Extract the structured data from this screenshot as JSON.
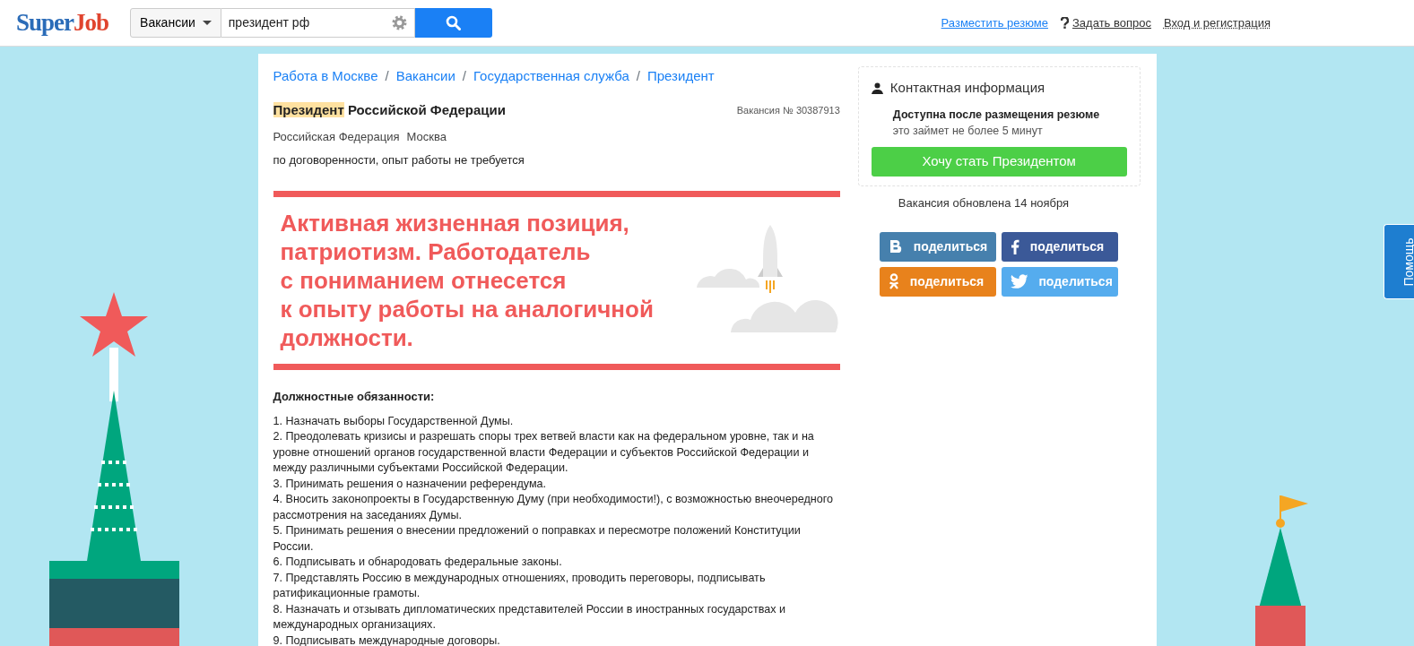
{
  "header": {
    "logo": {
      "first": "Super",
      "second": "Job"
    },
    "search_type": "Вакансии",
    "search_value": "президент рф",
    "links": [
      {
        "kind": "resume",
        "label": "Разместить резюме"
      },
      {
        "kind": "question",
        "label": "Задать вопрос"
      },
      {
        "kind": "login",
        "label": "Вход и регистрация"
      }
    ]
  },
  "breadcrumbs": {
    "separator": "/",
    "items": [
      "Работа в Москве",
      "Вакансии",
      "Государственная служба",
      "Президент"
    ]
  },
  "vacancy": {
    "title_highlight": "Президент",
    "title_rest": "Российской Федерации",
    "number": "Вакансия № 30387913",
    "region": "Российская Федерация",
    "city": "Москва",
    "terms": "по договоренности, опыт работы не требуется"
  },
  "banner": {
    "lines": [
      "Активная жизненная позиция,",
      "патриотизм. Работодатель",
      "с пониманием отнесется",
      "к опыту работы на аналогичной",
      "должности."
    ]
  },
  "duties": {
    "heading": "Должностные обязанности:",
    "items": [
      "1. Назначать выборы Государственной Думы.",
      "2. Преодолевать кризисы и разрешать споры трех ветвей власти как на федеральном уровне, так и на уровне отношений органов государственной власти Федерации и субъектов Российской Федерации и между различными субъектами Российской Федерации.",
      "3. Принимать решения о назначении референдума.",
      "4. Вносить законопроекты в Государственную Думу (при необходимости!), с возможностью внеочередного рассмотрения на заседаниях Думы.",
      "5. Принимать решения о внесении предложений о поправках и пересмотре положений Конституции России.",
      "6. Подписывать и обнародовать федеральные законы.",
      "7. Представлять Россию в международных отношениях, проводить переговоры, подписывать ратификационные грамоты.",
      "8. Назначать и отзывать дипломатических представителей России в иностранных государствах и международных организациях.",
      "9. Подписывать международные договоры."
    ]
  },
  "contact": {
    "title": "Контактная информация",
    "note": "Доступна после размещения резюме",
    "hint": "это займет не более 5 минут",
    "button": "Хочу стать Президентом"
  },
  "updated": "Вакансия обновлена 14 ноября",
  "share": [
    {
      "kind": "vk",
      "label": "поделиться",
      "color": "#4680ad"
    },
    {
      "kind": "fb",
      "label": "поделиться",
      "color": "#3b5998"
    },
    {
      "kind": "ok",
      "label": "поделиться",
      "color": "#e8821c"
    },
    {
      "kind": "tw",
      "label": "поделиться",
      "color": "#55acee"
    }
  ],
  "help_tab": "Помощь"
}
